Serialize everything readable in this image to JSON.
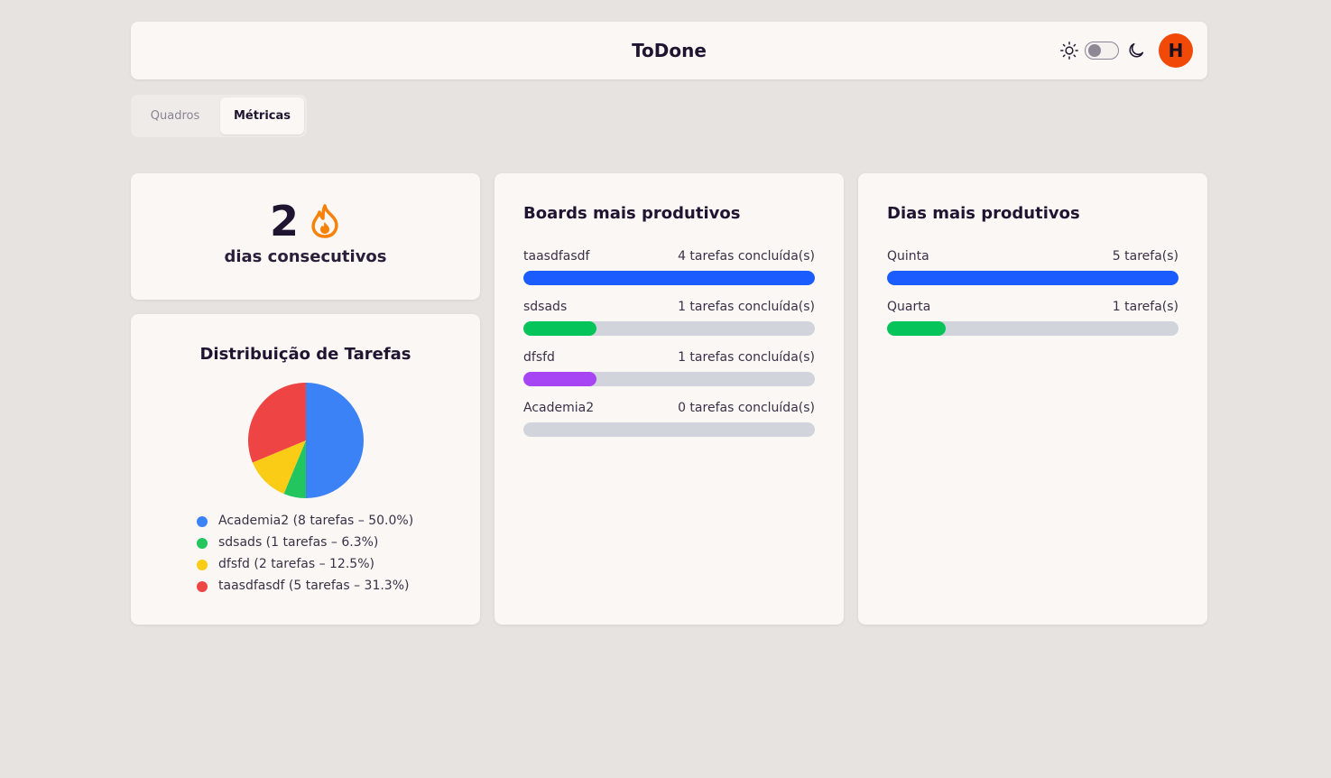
{
  "header": {
    "title": "ToDone",
    "avatar_initial": "H"
  },
  "tabs": [
    {
      "label": "Quadros",
      "active": false
    },
    {
      "label": "Métricas",
      "active": true
    }
  ],
  "streak": {
    "count": "2",
    "label": "dias consecutivos"
  },
  "boards": {
    "title": "Boards mais produtivos",
    "items": [
      {
        "name": "taasdfasdf",
        "value": "4 tarefas concluída(s)",
        "fraction": 1.0,
        "color": "#1a5cff"
      },
      {
        "name": "sdsads",
        "value": "1 tarefas concluída(s)",
        "fraction": 0.25,
        "color": "#04c45a"
      },
      {
        "name": "dfsfd",
        "value": "1 tarefas concluída(s)",
        "fraction": 0.25,
        "color": "#a745f5"
      },
      {
        "name": "Academia2",
        "value": "0 tarefas concluída(s)",
        "fraction": 0.0,
        "color": "#1a5cff"
      }
    ]
  },
  "days": {
    "title": "Dias mais produtivos",
    "items": [
      {
        "name": "Quinta",
        "value": "5 tarefa(s)",
        "fraction": 1.0,
        "color": "#1a5cff"
      },
      {
        "name": "Quarta",
        "value": "1 tarefa(s)",
        "fraction": 0.2,
        "color": "#04c45a"
      }
    ]
  },
  "distribution": {
    "title": "Distribuição de Tarefas",
    "legend": [
      "Academia2 (8 tarefas – 50.0%)",
      "sdsads (1 tarefas – 6.3%)",
      "dfsfd (2 tarefas – 12.5%)",
      "taasdfasdf (5 tarefas – 31.3%)"
    ]
  },
  "chart_data": {
    "type": "pie",
    "title": "Distribuição de Tarefas",
    "categories": [
      "Academia2",
      "sdsads",
      "dfsfd",
      "taasdfasdf"
    ],
    "values": [
      8,
      1,
      2,
      5
    ],
    "colors": [
      "#3b82f6",
      "#22c55e",
      "#facc15",
      "#ef4444"
    ],
    "legend": "bottom"
  },
  "icons": {
    "sun": "sun-icon",
    "moon": "moon-icon",
    "fire": "fire-icon"
  },
  "colors": {
    "accent_avatar": "#f14a08",
    "fire": "#f7820a"
  }
}
